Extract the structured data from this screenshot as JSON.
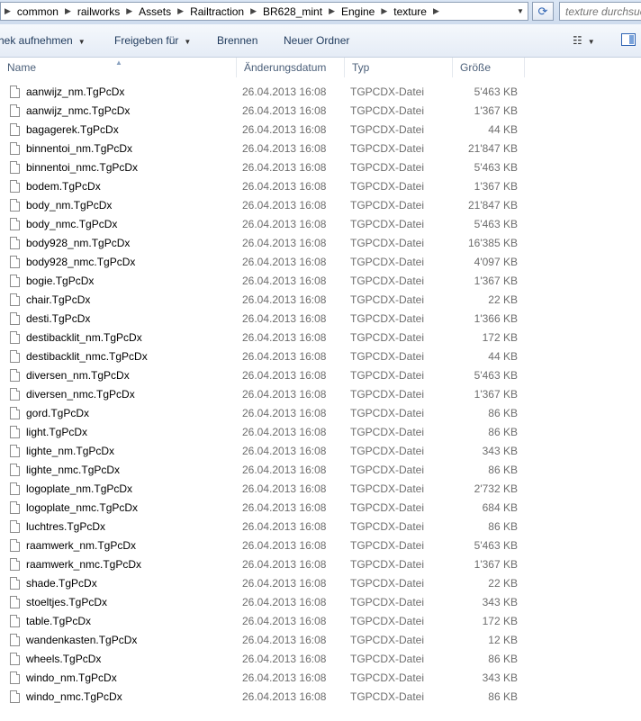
{
  "address_bar": {
    "breadcrumbs": [
      "common",
      "railworks",
      "Assets",
      "Railtraction",
      "BR628_mint",
      "Engine",
      "texture"
    ],
    "search_placeholder": "texture durchsuchen"
  },
  "toolbar": {
    "include_library": "hek aufnehmen",
    "share_with": "Freigeben für",
    "burn": "Brennen",
    "new_folder": "Neuer Ordner"
  },
  "columns": {
    "name": "Name",
    "date": "Änderungsdatum",
    "type": "Typ",
    "size": "Größe"
  },
  "files": [
    {
      "name": "aanwijz_nm.TgPcDx",
      "date": "26.04.2013 16:08",
      "type": "TGPCDX-Datei",
      "size": "5'463 KB"
    },
    {
      "name": "aanwijz_nmc.TgPcDx",
      "date": "26.04.2013 16:08",
      "type": "TGPCDX-Datei",
      "size": "1'367 KB"
    },
    {
      "name": "bagagerek.TgPcDx",
      "date": "26.04.2013 16:08",
      "type": "TGPCDX-Datei",
      "size": "44 KB"
    },
    {
      "name": "binnentoi_nm.TgPcDx",
      "date": "26.04.2013 16:08",
      "type": "TGPCDX-Datei",
      "size": "21'847 KB"
    },
    {
      "name": "binnentoi_nmc.TgPcDx",
      "date": "26.04.2013 16:08",
      "type": "TGPCDX-Datei",
      "size": "5'463 KB"
    },
    {
      "name": "bodem.TgPcDx",
      "date": "26.04.2013 16:08",
      "type": "TGPCDX-Datei",
      "size": "1'367 KB"
    },
    {
      "name": "body_nm.TgPcDx",
      "date": "26.04.2013 16:08",
      "type": "TGPCDX-Datei",
      "size": "21'847 KB"
    },
    {
      "name": "body_nmc.TgPcDx",
      "date": "26.04.2013 16:08",
      "type": "TGPCDX-Datei",
      "size": "5'463 KB"
    },
    {
      "name": "body928_nm.TgPcDx",
      "date": "26.04.2013 16:08",
      "type": "TGPCDX-Datei",
      "size": "16'385 KB"
    },
    {
      "name": "body928_nmc.TgPcDx",
      "date": "26.04.2013 16:08",
      "type": "TGPCDX-Datei",
      "size": "4'097 KB"
    },
    {
      "name": "bogie.TgPcDx",
      "date": "26.04.2013 16:08",
      "type": "TGPCDX-Datei",
      "size": "1'367 KB"
    },
    {
      "name": "chair.TgPcDx",
      "date": "26.04.2013 16:08",
      "type": "TGPCDX-Datei",
      "size": "22 KB"
    },
    {
      "name": "desti.TgPcDx",
      "date": "26.04.2013 16:08",
      "type": "TGPCDX-Datei",
      "size": "1'366 KB"
    },
    {
      "name": "destibacklit_nm.TgPcDx",
      "date": "26.04.2013 16:08",
      "type": "TGPCDX-Datei",
      "size": "172 KB"
    },
    {
      "name": "destibacklit_nmc.TgPcDx",
      "date": "26.04.2013 16:08",
      "type": "TGPCDX-Datei",
      "size": "44 KB"
    },
    {
      "name": "diversen_nm.TgPcDx",
      "date": "26.04.2013 16:08",
      "type": "TGPCDX-Datei",
      "size": "5'463 KB"
    },
    {
      "name": "diversen_nmc.TgPcDx",
      "date": "26.04.2013 16:08",
      "type": "TGPCDX-Datei",
      "size": "1'367 KB"
    },
    {
      "name": "gord.TgPcDx",
      "date": "26.04.2013 16:08",
      "type": "TGPCDX-Datei",
      "size": "86 KB"
    },
    {
      "name": "light.TgPcDx",
      "date": "26.04.2013 16:08",
      "type": "TGPCDX-Datei",
      "size": "86 KB"
    },
    {
      "name": "lighte_nm.TgPcDx",
      "date": "26.04.2013 16:08",
      "type": "TGPCDX-Datei",
      "size": "343 KB"
    },
    {
      "name": "lighte_nmc.TgPcDx",
      "date": "26.04.2013 16:08",
      "type": "TGPCDX-Datei",
      "size": "86 KB"
    },
    {
      "name": "logoplate_nm.TgPcDx",
      "date": "26.04.2013 16:08",
      "type": "TGPCDX-Datei",
      "size": "2'732 KB"
    },
    {
      "name": "logoplate_nmc.TgPcDx",
      "date": "26.04.2013 16:08",
      "type": "TGPCDX-Datei",
      "size": "684 KB"
    },
    {
      "name": "luchtres.TgPcDx",
      "date": "26.04.2013 16:08",
      "type": "TGPCDX-Datei",
      "size": "86 KB"
    },
    {
      "name": "raamwerk_nm.TgPcDx",
      "date": "26.04.2013 16:08",
      "type": "TGPCDX-Datei",
      "size": "5'463 KB"
    },
    {
      "name": "raamwerk_nmc.TgPcDx",
      "date": "26.04.2013 16:08",
      "type": "TGPCDX-Datei",
      "size": "1'367 KB"
    },
    {
      "name": "shade.TgPcDx",
      "date": "26.04.2013 16:08",
      "type": "TGPCDX-Datei",
      "size": "22 KB"
    },
    {
      "name": "stoeltjes.TgPcDx",
      "date": "26.04.2013 16:08",
      "type": "TGPCDX-Datei",
      "size": "343 KB"
    },
    {
      "name": "table.TgPcDx",
      "date": "26.04.2013 16:08",
      "type": "TGPCDX-Datei",
      "size": "172 KB"
    },
    {
      "name": "wandenkasten.TgPcDx",
      "date": "26.04.2013 16:08",
      "type": "TGPCDX-Datei",
      "size": "12 KB"
    },
    {
      "name": "wheels.TgPcDx",
      "date": "26.04.2013 16:08",
      "type": "TGPCDX-Datei",
      "size": "86 KB"
    },
    {
      "name": "windo_nm.TgPcDx",
      "date": "26.04.2013 16:08",
      "type": "TGPCDX-Datei",
      "size": "343 KB"
    },
    {
      "name": "windo_nmc.TgPcDx",
      "date": "26.04.2013 16:08",
      "type": "TGPCDX-Datei",
      "size": "86 KB"
    }
  ]
}
